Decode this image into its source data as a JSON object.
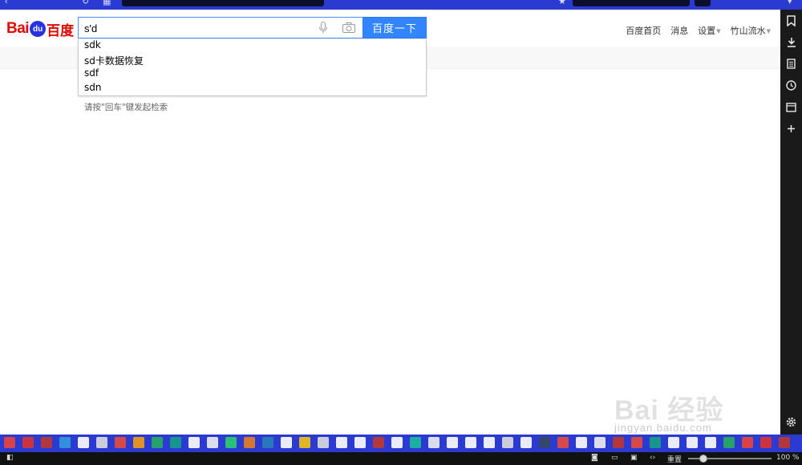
{
  "header": {
    "logo_bai": "Bai",
    "logo_du": "du",
    "logo_cn": "百度"
  },
  "search": {
    "value": "s'd",
    "button_label": "百度一下"
  },
  "top_links": {
    "home": "百度首页",
    "messages": "消息",
    "settings": "设置",
    "user": "竹山流水"
  },
  "suggestions": [
    "sdk",
    "sd卡数据恢复",
    "sdf",
    "sdn"
  ],
  "hint": "请按\"回车\"键发起检索",
  "watermark": {
    "main": "Bai 经验",
    "sub": "jingyan.baidu.com"
  },
  "statusbar": {
    "reset": "重置",
    "zoom": "100 %"
  },
  "colors": {
    "baidu_red": "#e10601",
    "baidu_blue": "#2932e1",
    "search_button": "#3385ff",
    "toolbar_blue": "#2b3ad1"
  },
  "icons": {
    "sidebar": [
      "bookmark-icon",
      "download-icon",
      "notes-icon",
      "history-icon",
      "window-icon",
      "add-icon",
      "settings-icon"
    ]
  }
}
